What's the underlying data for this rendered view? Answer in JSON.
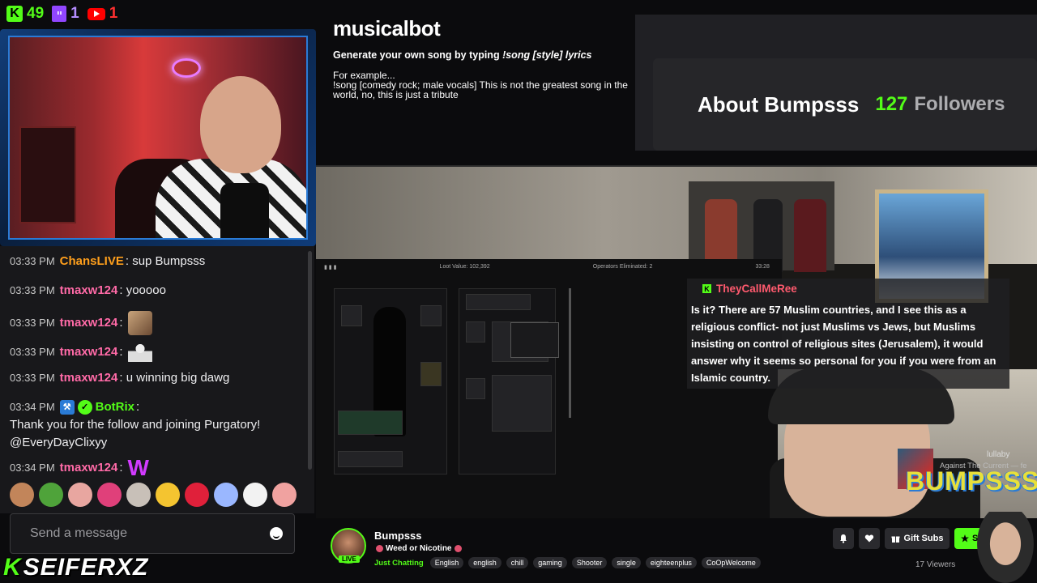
{
  "counters": {
    "kick": "49",
    "twitch": "1",
    "youtube": "1"
  },
  "musicalbot": {
    "logo": "musicalbot",
    "tagline_prefix": "Generate your own song by typing ",
    "tagline_cmd": "!song [style] lyrics",
    "example_label": "For example...",
    "example_text": "!song [comedy rock; male vocals] This is not the greatest song in the world, no, this is just a tribute"
  },
  "about": {
    "title": "About Bumpsss",
    "followers_count": "127",
    "followers_label": "Followers"
  },
  "chat": {
    "messages": [
      {
        "time": "03:33 PM",
        "user": "ChansLIVE",
        "text": "sup Bumpsss"
      },
      {
        "time": "03:33 PM",
        "user": "tmaxw124",
        "text": "yooooo"
      },
      {
        "time": "03:33 PM",
        "user": "tmaxw124",
        "text": ""
      },
      {
        "time": "03:33 PM",
        "user": "tmaxw124",
        "text": ""
      },
      {
        "time": "03:33 PM",
        "user": "tmaxw124",
        "text": "u winning big dawg"
      },
      {
        "time": "03:34 PM",
        "user": "BotRix",
        "text": "Thank you for the follow and joining Purgatory! @EveryDayClixyy"
      },
      {
        "time": "03:34 PM",
        "user": "tmaxw124",
        "text": ""
      }
    ],
    "w_emote": "W",
    "input_placeholder": "Send a message"
  },
  "overlay_message": {
    "user": "TheyCallMeRee",
    "text": "Is it? There are 57 Muslim countries, and I see this as a religious conflict- not just Muslims vs Jews, but Muslims insisting on control of religious sites (Jerusalem), it would answer why it seems so personal for you if you were from an Islamic country."
  },
  "now_playing": {
    "title": "lullaby",
    "subtitle": "Against The Current — fe",
    "brand": "BUMPSSS"
  },
  "stream_info": {
    "channel": "Bumpsss",
    "live_label": "LIVE",
    "title": "Weed or Nicotine",
    "category": "Just Chatting",
    "tags": [
      "English",
      "english",
      "chill",
      "gaming",
      "Shooter",
      "single",
      "eighteenplus",
      "CoOpWelcome"
    ],
    "gift_label": "Gift Subs",
    "sub_label": "Su",
    "viewers": "17 Viewers"
  },
  "game_hud": {
    "loot_value": "Loot Value: 102,392",
    "operators": "Operators Eliminated: 2",
    "timer": "33:28"
  },
  "brand_watermark": {
    "k": "K",
    "text": "SEIFERXZ"
  },
  "colors": {
    "kick_green": "#53fc18",
    "twitch_purple": "#9146ff",
    "youtube_red": "#ff0000",
    "chat_bg": "#18181b",
    "user_pink": "#ff6aa7",
    "user_orange": "#ff9f1c"
  }
}
